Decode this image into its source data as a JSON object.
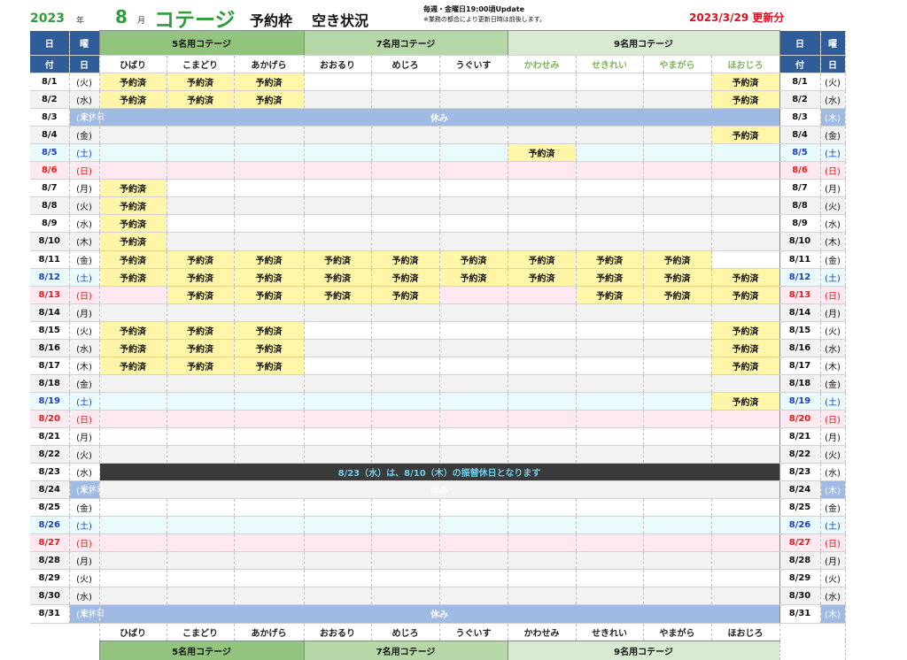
{
  "header": {
    "year": "2023",
    "year_unit": "年",
    "month": "8",
    "month_unit": "月",
    "cottage": "コテージ",
    "reservation": "予約枠",
    "availability": "空き状況",
    "note_update": "毎週・金曜日19:00頃Update",
    "note_business": "※業務の都合により更新日時は前後します。",
    "updated": "2023/3/29 更新分"
  },
  "labels": {
    "day_top": "日",
    "day_bottom": "付",
    "weekday_top": "曜",
    "weekday_bottom": "日",
    "booked": "予約済",
    "closed": "休み",
    "regular_holiday": "定休日",
    "notice_0823": "8/23（水）は、8/10（木）の振替休日となります"
  },
  "groups": [
    {
      "name": "5名用コテージ",
      "cottages": [
        "ひばり",
        "こまどり",
        "あかげら"
      ]
    },
    {
      "name": "7名用コテージ",
      "cottages": [
        "おおるり",
        "めじろ",
        "うぐいす"
      ]
    },
    {
      "name": "9名用コテージ",
      "cottages": [
        "かわせみ",
        "せきれい",
        "やまがら",
        "ほおじろ"
      ]
    }
  ],
  "days": [
    {
      "d": "8/1",
      "w": "(火)",
      "b": [
        1,
        1,
        1,
        0,
        0,
        0,
        0,
        0,
        0,
        1
      ]
    },
    {
      "d": "8/2",
      "w": "(水)",
      "b": [
        1,
        1,
        1,
        0,
        0,
        0,
        0,
        0,
        0,
        1
      ]
    },
    {
      "d": "8/3",
      "w": "(木)",
      "closed": true
    },
    {
      "d": "8/4",
      "w": "(金)",
      "b": [
        0,
        0,
        0,
        0,
        0,
        0,
        0,
        0,
        0,
        1
      ]
    },
    {
      "d": "8/5",
      "w": "(土)",
      "b": [
        0,
        0,
        0,
        0,
        0,
        0,
        1,
        0,
        0,
        0
      ]
    },
    {
      "d": "8/6",
      "w": "(日)",
      "b": [
        0,
        0,
        0,
        0,
        0,
        0,
        0,
        0,
        0,
        0
      ]
    },
    {
      "d": "8/7",
      "w": "(月)",
      "b": [
        1,
        0,
        0,
        0,
        0,
        0,
        0,
        0,
        0,
        0
      ]
    },
    {
      "d": "8/8",
      "w": "(火)",
      "b": [
        1,
        0,
        0,
        0,
        0,
        0,
        0,
        0,
        0,
        0
      ]
    },
    {
      "d": "8/9",
      "w": "(水)",
      "b": [
        1,
        0,
        0,
        0,
        0,
        0,
        0,
        0,
        0,
        0
      ]
    },
    {
      "d": "8/10",
      "w": "(木)",
      "b": [
        1,
        0,
        0,
        0,
        0,
        0,
        0,
        0,
        0,
        0
      ]
    },
    {
      "d": "8/11",
      "w": "(金)",
      "b": [
        1,
        1,
        1,
        1,
        1,
        1,
        1,
        1,
        1,
        0
      ]
    },
    {
      "d": "8/12",
      "w": "(土)",
      "b": [
        1,
        1,
        1,
        1,
        1,
        1,
        1,
        1,
        1,
        1
      ]
    },
    {
      "d": "8/13",
      "w": "(日)",
      "b": [
        0,
        1,
        1,
        1,
        1,
        0,
        0,
        1,
        1,
        1
      ]
    },
    {
      "d": "8/14",
      "w": "(月)",
      "b": [
        0,
        0,
        0,
        0,
        0,
        0,
        0,
        0,
        0,
        0
      ]
    },
    {
      "d": "8/15",
      "w": "(火)",
      "b": [
        1,
        1,
        1,
        0,
        0,
        0,
        0,
        0,
        0,
        1
      ]
    },
    {
      "d": "8/16",
      "w": "(水)",
      "b": [
        1,
        1,
        1,
        0,
        0,
        0,
        0,
        0,
        0,
        1
      ]
    },
    {
      "d": "8/17",
      "w": "(木)",
      "b": [
        1,
        1,
        1,
        0,
        0,
        0,
        0,
        0,
        0,
        1
      ]
    },
    {
      "d": "8/18",
      "w": "(金)",
      "b": [
        0,
        0,
        0,
        0,
        0,
        0,
        0,
        0,
        0,
        0
      ]
    },
    {
      "d": "8/19",
      "w": "(土)",
      "b": [
        0,
        0,
        0,
        0,
        0,
        0,
        0,
        0,
        0,
        1
      ]
    },
    {
      "d": "8/20",
      "w": "(日)",
      "b": [
        0,
        0,
        0,
        0,
        0,
        0,
        0,
        0,
        0,
        0
      ]
    },
    {
      "d": "8/21",
      "w": "(月)",
      "b": [
        0,
        0,
        0,
        0,
        0,
        0,
        0,
        0,
        0,
        0
      ]
    },
    {
      "d": "8/22",
      "w": "(火)",
      "b": [
        0,
        0,
        0,
        0,
        0,
        0,
        0,
        0,
        0,
        0
      ]
    },
    {
      "d": "8/23",
      "w": "(水)",
      "notice": true
    },
    {
      "d": "8/24",
      "w": "(木)",
      "closed": true
    },
    {
      "d": "8/25",
      "w": "(金)",
      "b": [
        0,
        0,
        0,
        0,
        0,
        0,
        0,
        0,
        0,
        0
      ]
    },
    {
      "d": "8/26",
      "w": "(土)",
      "b": [
        0,
        0,
        0,
        0,
        0,
        0,
        0,
        0,
        0,
        0
      ]
    },
    {
      "d": "8/27",
      "w": "(日)",
      "b": [
        0,
        0,
        0,
        0,
        0,
        0,
        0,
        0,
        0,
        0
      ]
    },
    {
      "d": "8/28",
      "w": "(月)",
      "b": [
        0,
        0,
        0,
        0,
        0,
        0,
        0,
        0,
        0,
        0
      ]
    },
    {
      "d": "8/29",
      "w": "(火)",
      "b": [
        0,
        0,
        0,
        0,
        0,
        0,
        0,
        0,
        0,
        0
      ]
    },
    {
      "d": "8/30",
      "w": "(水)",
      "b": [
        0,
        0,
        0,
        0,
        0,
        0,
        0,
        0,
        0,
        0
      ]
    },
    {
      "d": "8/31",
      "w": "(木)",
      "closed": true
    }
  ]
}
